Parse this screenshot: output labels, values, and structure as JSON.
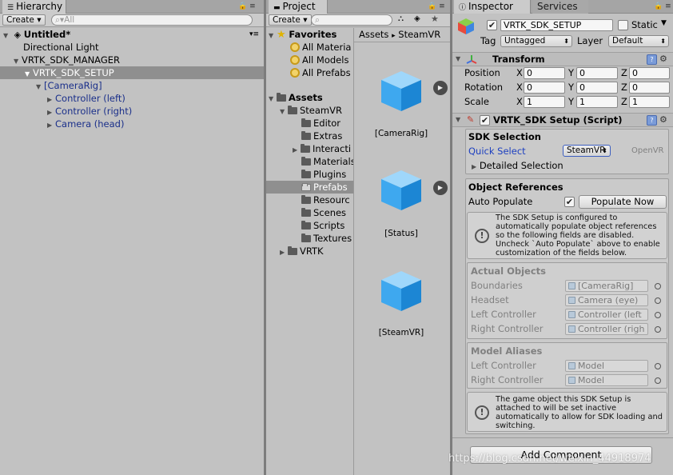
{
  "hierarchy": {
    "tab_label": "Hierarchy",
    "create_label": "Create",
    "search_placeholder": "All",
    "scene_name": "Untitled*",
    "items": [
      {
        "label": "Directional Light"
      },
      {
        "label": "VRTK_SDK_MANAGER"
      },
      {
        "label": "VRTK_SDK_SETUP"
      },
      {
        "label": "[CameraRig]"
      },
      {
        "label": "Controller (left)"
      },
      {
        "label": "Controller (right)"
      },
      {
        "label": "Camera (head)"
      }
    ]
  },
  "project": {
    "tab_label": "Project",
    "create_label": "Create",
    "favorites": {
      "label": "Favorites",
      "items": [
        {
          "label": "All Materia"
        },
        {
          "label": "All Models"
        },
        {
          "label": "All Prefabs"
        }
      ]
    },
    "assets": {
      "label": "Assets",
      "steamvr": "SteamVR",
      "children": [
        {
          "label": "Editor"
        },
        {
          "label": "Extras"
        },
        {
          "label": "Interacti"
        },
        {
          "label": "Materials"
        },
        {
          "label": "Plugins"
        },
        {
          "label": "Prefabs"
        },
        {
          "label": "Resourc"
        },
        {
          "label": "Scenes"
        },
        {
          "label": "Scripts"
        },
        {
          "label": "Textures"
        }
      ],
      "vrtk": "VRTK"
    },
    "breadcrumb": {
      "root": "Assets",
      "sep": "▸",
      "current": "SteamVR"
    },
    "prefabs": [
      {
        "label": "[CameraRig]"
      },
      {
        "label": "[Status]"
      },
      {
        "label": "[SteamVR]"
      }
    ]
  },
  "inspector": {
    "tab_label": "Inspector",
    "services_label": "Services",
    "object_name": "VRTK_SDK_SETUP",
    "static_label": "Static",
    "tag_label": "Tag",
    "tag_value": "Untagged",
    "layer_label": "Layer",
    "layer_value": "Default",
    "transform": {
      "title": "Transform",
      "position_label": "Position",
      "rotation_label": "Rotation",
      "scale_label": "Scale",
      "axis_x": "X",
      "axis_y": "Y",
      "axis_z": "Z",
      "position": [
        "0",
        "0",
        "0"
      ],
      "rotation": [
        "0",
        "0",
        "0"
      ],
      "scale": [
        "1",
        "1",
        "1"
      ]
    },
    "sdk_setup": {
      "title": "VRTK_SDK Setup (Script)",
      "sdk_selection_title": "SDK Selection",
      "quick_select_label": "Quick Select",
      "quick_select_value": "SteamVR",
      "openvr_label": "OpenVR",
      "detailed_selection_label": "Detailed Selection",
      "object_refs_title": "Object References",
      "auto_populate_label": "Auto Populate",
      "populate_now_label": "Populate Now",
      "help_text_1": "The SDK Setup is configured to automatically populate object references so the following fields are disabled. Uncheck `Auto Populate` above to enable customization of the fields below.",
      "actual_objects_title": "Actual Objects",
      "actual_objects": [
        {
          "label": "Boundaries",
          "value": "[CameraRig]"
        },
        {
          "label": "Headset",
          "value": "Camera (eye)"
        },
        {
          "label": "Left Controller",
          "value": "Controller (left"
        },
        {
          "label": "Right Controller",
          "value": "Controller (righ"
        }
      ],
      "model_aliases_title": "Model Aliases",
      "model_aliases": [
        {
          "label": "Left Controller",
          "value": "Model"
        },
        {
          "label": "Right Controller",
          "value": "Model"
        }
      ],
      "help_text_2": "The game object this SDK Setup is attached to will be set inactive automatically to allow for SDK loading and switching."
    },
    "add_component_label": "Add Component"
  },
  "watermark": "https://blog.csdn.net/weixin_44918974"
}
